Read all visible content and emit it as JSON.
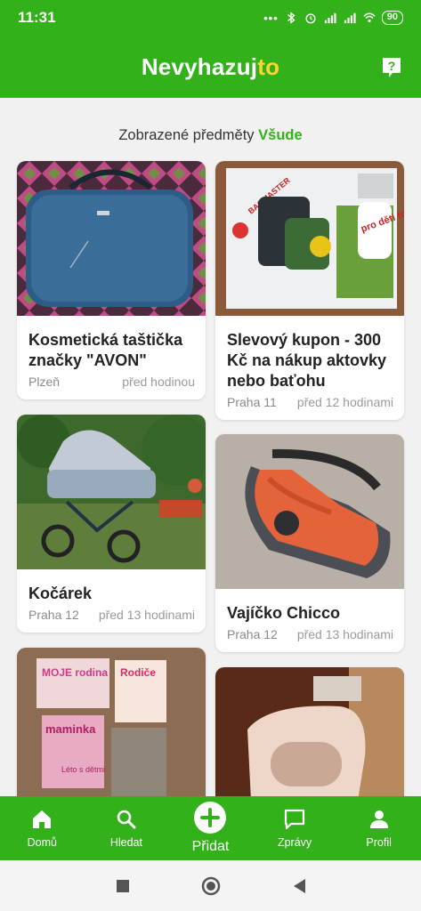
{
  "status_bar": {
    "time": "11:31",
    "battery": "90"
  },
  "app_bar": {
    "logo_main": "Nevyhazuj",
    "logo_accent": "to"
  },
  "filter": {
    "label": "Zobrazené předměty",
    "value": "Všude"
  },
  "items": [
    {
      "title": "Kosmetická taštička značky \"AVON\"",
      "location": "Plzeň",
      "time": "před hodinou"
    },
    {
      "title": "Slevový kupon - 300 Kč na nákup aktovky nebo baťohu",
      "location": "Praha 11",
      "time": "před 12 hodinami"
    },
    {
      "title": "Kočárek",
      "location": "Praha 12",
      "time": "před 13 hodinami"
    },
    {
      "title": "Vajíčko Chicco",
      "location": "Praha 12",
      "time": "před 13 hodinami"
    },
    {
      "title": "",
      "location": "",
      "time": ""
    },
    {
      "title": "",
      "location": "",
      "time": ""
    }
  ],
  "photo_text": {
    "coupon_brand": "BAGMASTER",
    "coupon_slogan": "pro děti to nejlepší",
    "magazine_1": "MOJE rodina",
    "magazine_2": "Rodiče",
    "magazine_3": "maminka",
    "magazine_4": "Léto s dětmi"
  },
  "bottom_nav": {
    "home": "Domů",
    "search": "Hledat",
    "add": "Přidat",
    "messages": "Zprávy",
    "profile": "Profil"
  },
  "colors": {
    "brand_green": "#32b11a",
    "logo_accent": "#ffd52b"
  }
}
